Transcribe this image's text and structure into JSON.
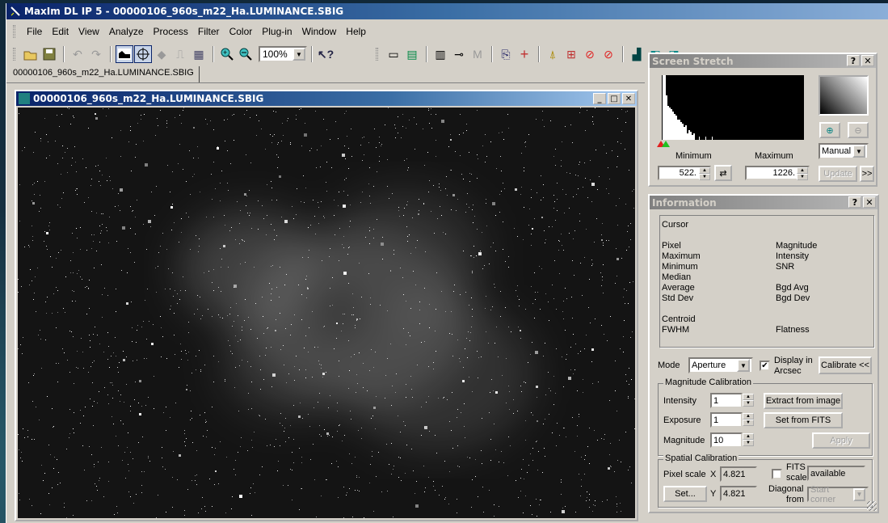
{
  "app": {
    "title": "MaxIm DL IP 5 - 00000106_960s_m22_Ha.LUMINANCE.SBIG"
  },
  "menu": [
    "File",
    "Edit",
    "View",
    "Analyze",
    "Process",
    "Filter",
    "Color",
    "Plug-in",
    "Window",
    "Help"
  ],
  "toolbar": {
    "zoom_value": "100%",
    "icons": [
      "open-icon",
      "save-icon",
      "undo-icon",
      "redo-icon",
      "screen-stretch-icon",
      "information-icon",
      "camera-icon",
      "telescope-icon",
      "properties-icon",
      "zoom-in-icon",
      "zoom-out-icon"
    ],
    "help_icon": "context-help-icon",
    "icons2": [
      "line-profile-icon",
      "multi-profile-icon",
      "calibrate-icon",
      "measure-icon",
      "magnitude-icon",
      "duplicate-icon",
      "crosshair-icon",
      "brush-icon",
      "kernel-icon",
      "no-flag-icon",
      "no-color-icon",
      "graph-icon",
      "overlay-icon",
      "overlay2-icon"
    ]
  },
  "tabs": [
    {
      "label": "00000106_960s_m22_Ha.LUMINANCE.SBIG"
    }
  ],
  "image_window": {
    "title": "00000106_960s_m22_Ha.LUMINANCE.SBIG"
  },
  "screen_stretch": {
    "title": "Screen Stretch",
    "minimum_label": "Minimum",
    "maximum_label": "Maximum",
    "minimum_value": "522.",
    "maximum_value": "1226.",
    "mode": "Manual",
    "update_label": "Update",
    "more_label": ">>"
  },
  "information": {
    "title": "Information",
    "cursor_label": "Cursor",
    "left_labels": [
      "Pixel",
      "Maximum",
      "Minimum",
      "Median",
      "Average",
      "Std Dev"
    ],
    "right_labels": [
      "Magnitude",
      "Intensity",
      "SNR",
      "",
      "Bgd Avg",
      "Bgd Dev"
    ],
    "centroid_label": "Centroid",
    "fwhm_label": "FWHM",
    "flatness_label": "Flatness",
    "mode_label": "Mode",
    "mode_value": "Aperture",
    "display_arcsec_label1": "Display in",
    "display_arcsec_label2": "Arcsec",
    "display_arcsec_checked": true,
    "calibrate_label": "Calibrate <<",
    "magnitude_calibration": {
      "title": "Magnitude Calibration",
      "intensity_label": "Intensity",
      "intensity_value": "1",
      "exposure_label": "Exposure",
      "exposure_value": "1",
      "magnitude_label": "Magnitude",
      "magnitude_value": "10",
      "extract_label": "Extract from image",
      "set_fits_label": "Set from FITS",
      "apply_label": "Apply"
    },
    "spatial_calibration": {
      "title": "Spatial Calibration",
      "pixel_scale_label": "Pixel scale",
      "x_label": "X",
      "x_value": "4.821",
      "y_label": "Y",
      "y_value": "4.821",
      "set_label": "Set...",
      "fits_scale_label1": "FITS",
      "fits_scale_label2": "scale",
      "fits_scale_checked": false,
      "fits_value": "available",
      "diagonal_label1": "Diagonal",
      "diagonal_label2": "from",
      "diagonal_value": "Start corner"
    }
  }
}
